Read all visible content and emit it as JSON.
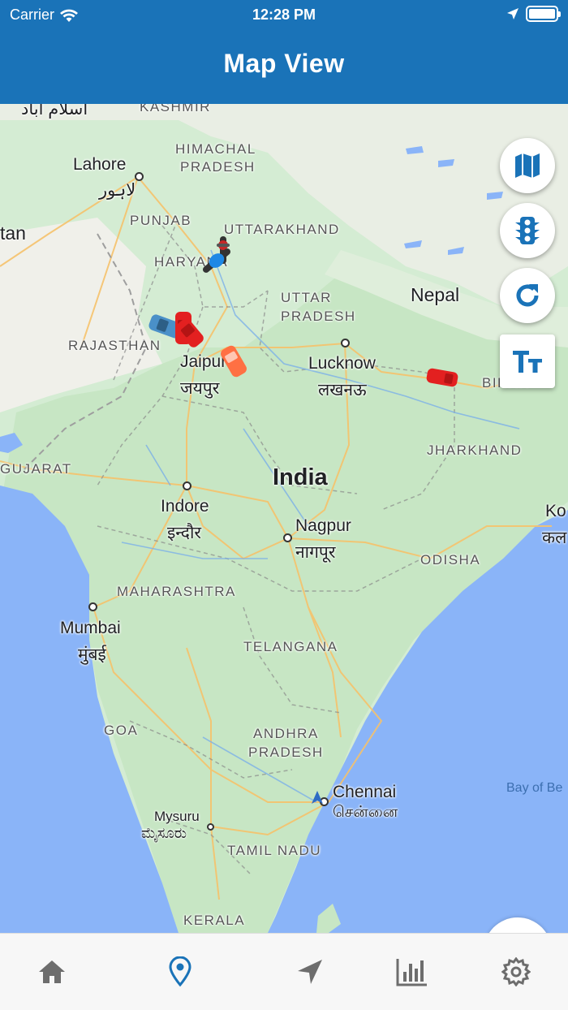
{
  "status_bar": {
    "carrier": "Carrier",
    "time": "12:28 PM",
    "icons": [
      "wifi-icon",
      "location-arrow-icon",
      "battery-icon"
    ]
  },
  "header": {
    "title": "Map View",
    "color": "#1a73b8"
  },
  "map": {
    "labels": {
      "kashmir": "KASHMIR",
      "islamabad": "اسلام آباد",
      "lahore": "Lahore",
      "lahore_native": "لاہور",
      "pakistan_partial": "tan",
      "himachal_1": "HIMACHAL",
      "himachal_2": "PRADESH",
      "punjab": "PUNJAB",
      "uttarakhand": "UTTARAKHAND",
      "haryana": "HARYANA",
      "nepal": "Nepal",
      "uttar_1": "UTTAR",
      "uttar_2": "PRADESH",
      "rajasthan": "RAJASTHAN",
      "jaipur": "Jaipur",
      "jaipur_native": "जयपुर",
      "lucknow": "Lucknow",
      "lucknow_native": "लखनऊ",
      "bihar": "BIHAR",
      "jharkhand": "JHARKHAND",
      "gujarat": "GUJARAT",
      "india": "India",
      "indore": "Indore",
      "indore_native": "इन्दौर",
      "nagpur": "Nagpur",
      "nagpur_native": "नागपूर",
      "kolkata_partial": "Ko",
      "kolkata_native_partial": "कल",
      "odisha": "ODISHA",
      "maharashtra": "MAHARASHTRA",
      "mumbai": "Mumbai",
      "mumbai_native": "मुंबई",
      "telangana": "TELANGANA",
      "goa": "GOA",
      "andhra_1": "ANDHRA",
      "andhra_2": "PRADESH",
      "chennai": "Chennai",
      "chennai_native": "சென்னை",
      "bay_of_bengal": "Bay of Be",
      "mysuru": "Mysuru",
      "mysuru_native": "ಮೈಸೂರು",
      "tamil_nadu": "TAMIL NADU",
      "kerala": "KERALA"
    },
    "controls": [
      "map-type-button",
      "traffic-button",
      "refresh-button",
      "text-size-button"
    ],
    "vehicles": [
      "motorbike",
      "scooter",
      "car-blue",
      "car-red",
      "car-red",
      "car-orange",
      "car-red",
      "navigation-arrow"
    ]
  },
  "tabbar": {
    "active_color": "#1a73b8",
    "inactive_color": "#6d6d6d",
    "tabs": [
      {
        "id": "home",
        "icon": "home-icon",
        "active": false
      },
      {
        "id": "map",
        "icon": "location-pin-icon",
        "active": true
      },
      {
        "id": "navigate",
        "icon": "navigation-icon",
        "active": false
      },
      {
        "id": "reports",
        "icon": "bar-chart-icon",
        "active": false
      },
      {
        "id": "settings",
        "icon": "gear-icon",
        "active": false
      }
    ]
  }
}
